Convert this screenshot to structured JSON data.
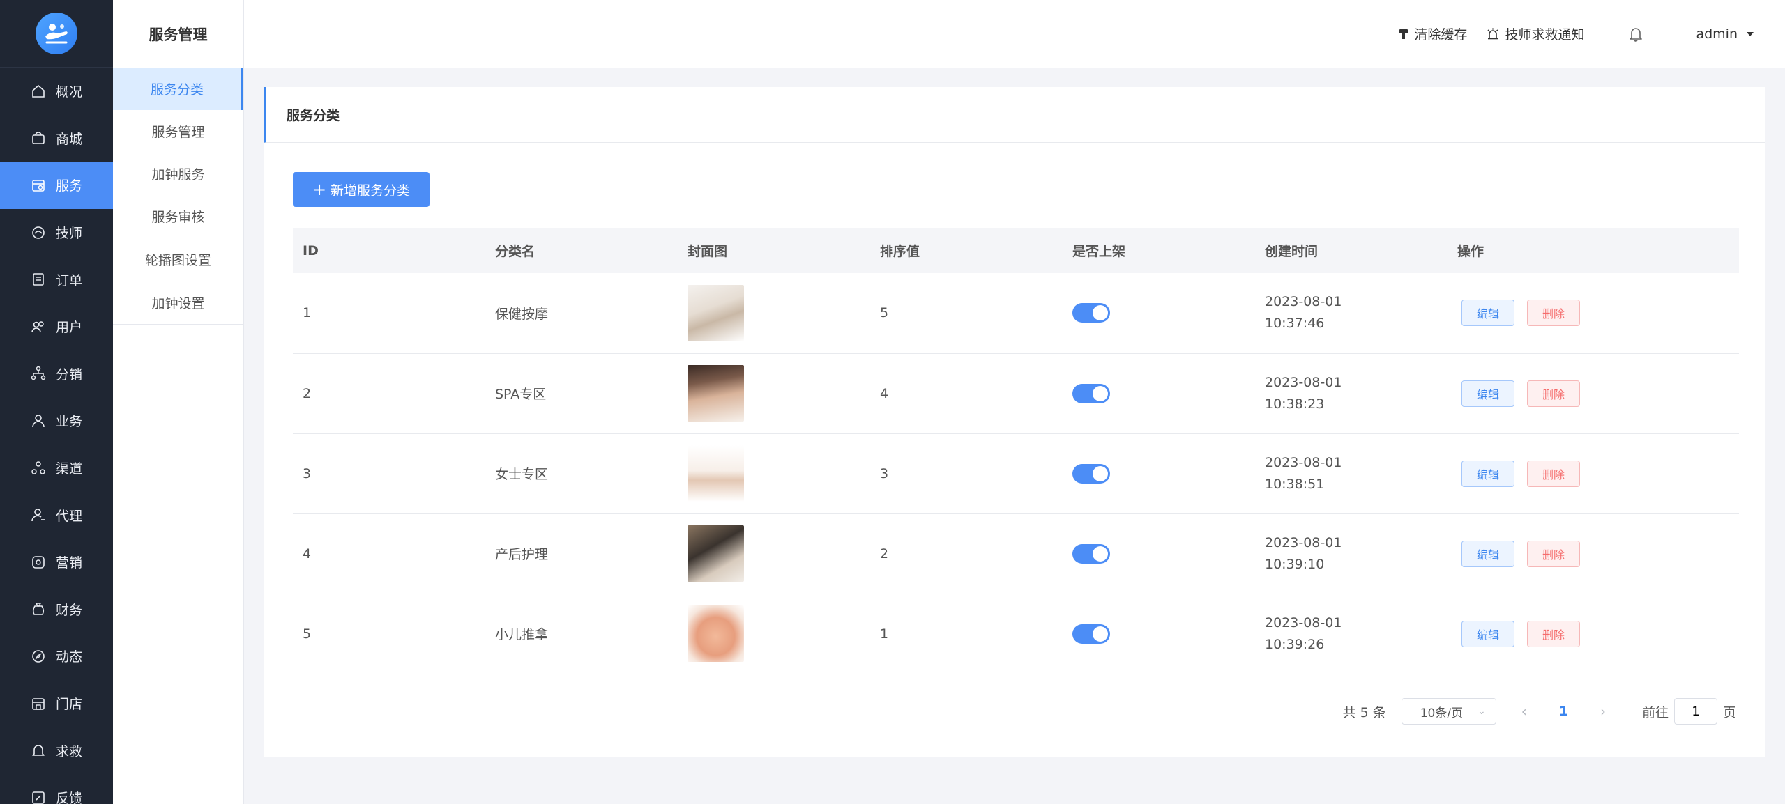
{
  "sidebar": {
    "items": [
      {
        "label": "概况",
        "icon": "home-icon"
      },
      {
        "label": "商城",
        "icon": "shopping-bag-icon"
      },
      {
        "label": "服务",
        "icon": "calendar-icon"
      },
      {
        "label": "技师",
        "icon": "massage-icon"
      },
      {
        "label": "订单",
        "icon": "document-icon"
      },
      {
        "label": "用户",
        "icon": "users-icon"
      },
      {
        "label": "分销",
        "icon": "hierarchy-icon"
      },
      {
        "label": "业务",
        "icon": "person-icon"
      },
      {
        "label": "渠道",
        "icon": "channel-icon"
      },
      {
        "label": "代理",
        "icon": "agent-icon"
      },
      {
        "label": "营销",
        "icon": "marketing-icon"
      },
      {
        "label": "财务",
        "icon": "money-bag-icon"
      },
      {
        "label": "动态",
        "icon": "compass-icon"
      },
      {
        "label": "门店",
        "icon": "store-icon"
      },
      {
        "label": "求救",
        "icon": "bell-icon"
      },
      {
        "label": "反馈",
        "icon": "feedback-icon"
      }
    ],
    "active_index": 2
  },
  "subnav": {
    "title": "服务管理",
    "group1": [
      "服务分类",
      "服务管理",
      "加钟服务",
      "服务审核"
    ],
    "group2": [
      "轮播图设置"
    ],
    "group3": [
      "加钟设置"
    ]
  },
  "header": {
    "clear_cache": "清除缓存",
    "sos_notice": "技师求救通知",
    "user": "admin"
  },
  "card": {
    "title": "服务分类",
    "add_button": "新增服务分类"
  },
  "table": {
    "columns": [
      "ID",
      "分类名",
      "封面图",
      "排序值",
      "是否上架",
      "创建时间",
      "操作"
    ],
    "edit_label": "编辑",
    "delete_label": "删除",
    "rows": [
      {
        "id": "1",
        "name": "保健按摩",
        "sort": "5",
        "on": true,
        "date": "2023-08-01",
        "time": "10:37:46"
      },
      {
        "id": "2",
        "name": "SPA专区",
        "sort": "4",
        "on": true,
        "date": "2023-08-01",
        "time": "10:38:23"
      },
      {
        "id": "3",
        "name": "女士专区",
        "sort": "3",
        "on": true,
        "date": "2023-08-01",
        "time": "10:38:51"
      },
      {
        "id": "4",
        "name": "产后护理",
        "sort": "2",
        "on": true,
        "date": "2023-08-01",
        "time": "10:39:10"
      },
      {
        "id": "5",
        "name": "小儿推拿",
        "sort": "1",
        "on": true,
        "date": "2023-08-01",
        "time": "10:39:26"
      }
    ]
  },
  "pager": {
    "total": "共 5 条",
    "page_size": "10条/页",
    "current": "1",
    "goto_prefix": "前往",
    "goto_value": "1",
    "goto_suffix": "页"
  },
  "colors": {
    "accent": "#4c8df6",
    "sidebar_bg": "#1f2633",
    "danger": "#f56c6c"
  }
}
